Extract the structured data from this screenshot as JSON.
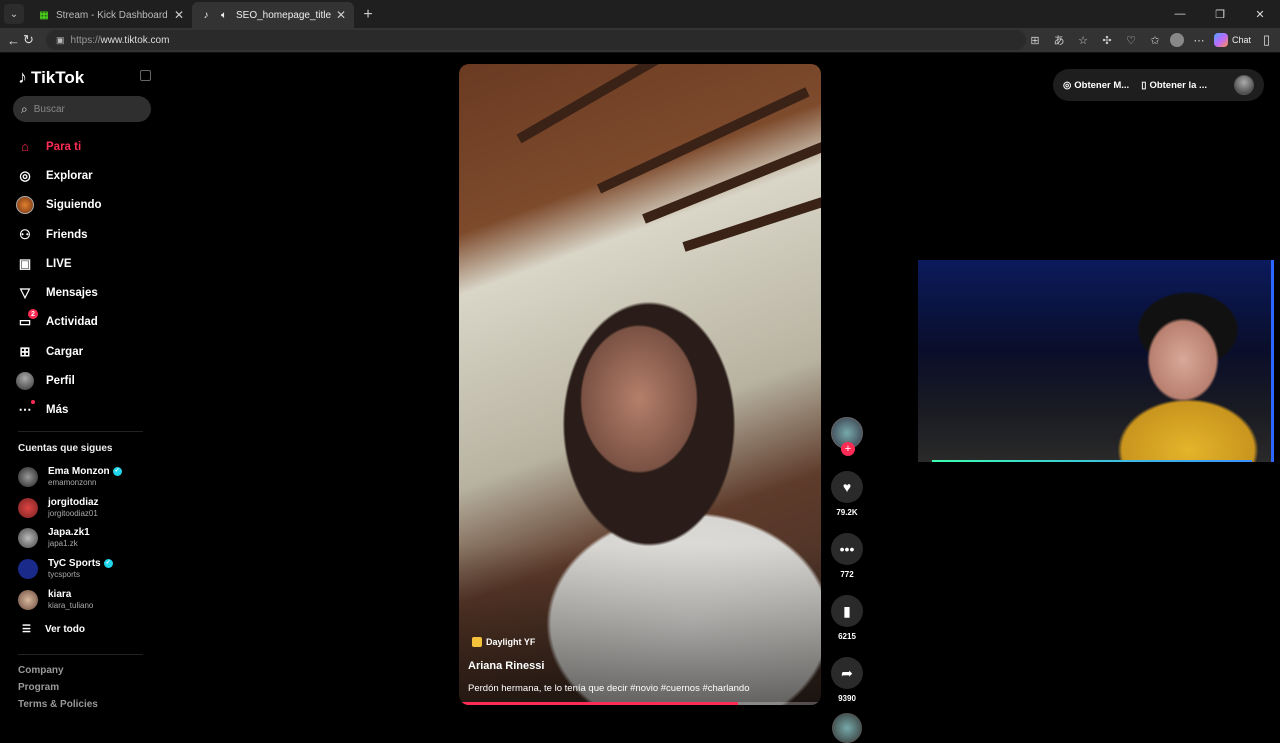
{
  "browser": {
    "tabs": [
      {
        "title": "Stream - Kick Dashboard",
        "favicon": "kick-icon",
        "active": false
      },
      {
        "title": "SEO_homepage_title",
        "favicon": "tiktok-icon",
        "active": true
      }
    ],
    "url_proto": "https://",
    "url_host": "www.tiktok.com",
    "chat_label": "Chat"
  },
  "tiktok": {
    "logo": "TikTok",
    "search_placeholder": "Buscar",
    "nav": [
      {
        "label": "Para ti",
        "icon": "home-icon",
        "active": true
      },
      {
        "label": "Explorar",
        "icon": "compass-icon"
      },
      {
        "label": "Siguiendo",
        "icon": "following-avatar-icon"
      },
      {
        "label": "Friends",
        "icon": "friends-icon"
      },
      {
        "label": "LIVE",
        "icon": "live-icon"
      },
      {
        "label": "Mensajes",
        "icon": "messages-icon"
      },
      {
        "label": "Actividad",
        "icon": "activity-icon",
        "badge": "2"
      },
      {
        "label": "Cargar",
        "icon": "upload-icon"
      },
      {
        "label": "Perfil",
        "icon": "profile-icon"
      },
      {
        "label": "Más",
        "icon": "more-icon"
      }
    ],
    "following_title": "Cuentas que sigues",
    "following": [
      {
        "name": "Ema Monzon",
        "username": "emamonzonn",
        "verified": true
      },
      {
        "name": "jorgitodiaz",
        "username": "jorgitoodiaz01",
        "verified": false
      },
      {
        "name": "Japa.zk1",
        "username": "japa1.zk",
        "verified": false
      },
      {
        "name": "TyC Sports",
        "username": "tycsports",
        "verified": true
      },
      {
        "name": "kiara",
        "username": "kiara_tuliano",
        "verified": false
      }
    ],
    "see_all": "Ver todo",
    "footer": [
      "Company",
      "Program",
      "Terms & Policies"
    ],
    "top_actions": [
      "Obtener M...",
      "Obtener la ..."
    ]
  },
  "video": {
    "sound": "Daylight YF",
    "author": "Ariana Rinessi",
    "caption": "Perdón hermana, te lo tenía que decir #novio #cuernos #charlando",
    "progress": 0.77,
    "likes": "79.2K",
    "comments": "772",
    "saves": "6215",
    "shares": "9390"
  }
}
